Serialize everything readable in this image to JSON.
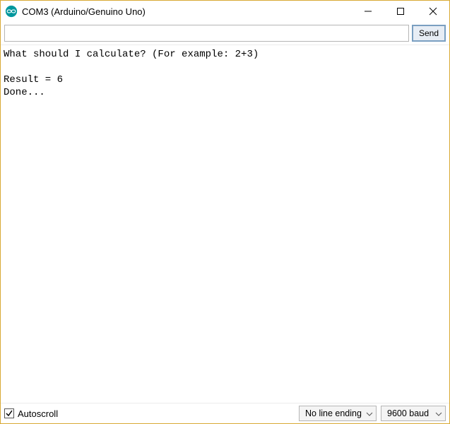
{
  "window": {
    "title": "COM3 (Arduino/Genuino Uno)"
  },
  "toolbar": {
    "send_label": "Send"
  },
  "input": {
    "value": ""
  },
  "output_text": "What should I calculate? (For example: 2+3)\n\nResult = 6\nDone...",
  "footer": {
    "autoscroll_label": "Autoscroll",
    "autoscroll_checked": true,
    "line_ending": "No line ending",
    "baud": "9600 baud"
  },
  "colors": {
    "arduino_teal": "#00979d"
  }
}
